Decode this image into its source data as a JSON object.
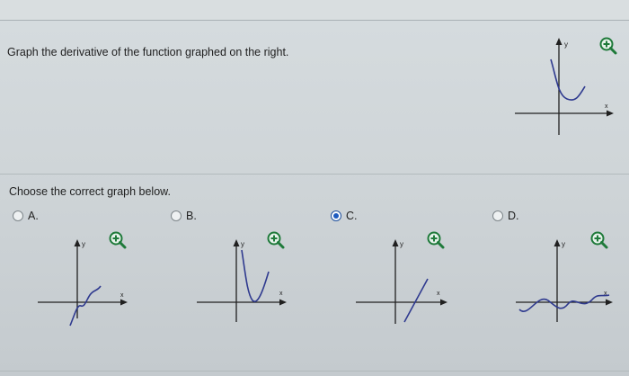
{
  "question": "Graph the derivative of the function graphed on the right.",
  "prompt": "Choose the correct graph below.",
  "axis_labels": {
    "y": "y",
    "x": "x"
  },
  "options": [
    {
      "label": "A.",
      "selected": false
    },
    {
      "label": "B.",
      "selected": false
    },
    {
      "label": "C.",
      "selected": true
    },
    {
      "label": "D.",
      "selected": false
    }
  ],
  "icons": {
    "zoom": "zoom-in-magnifier-icon",
    "radio": "radio-button"
  },
  "colors": {
    "curve": "#2f3a8f",
    "axis": "#202020",
    "zoom": "#1f7a3a",
    "radio_selected": "#1e5bbf"
  }
}
